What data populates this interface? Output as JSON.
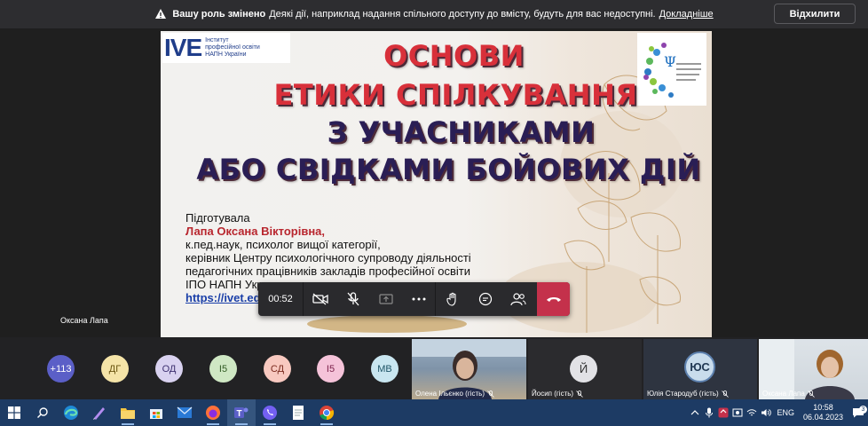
{
  "banner": {
    "bold": "Вашу роль змінено",
    "message": "Деякі дії, наприклад надання спільного доступу до вмісту, будуть для вас недоступні.",
    "link": "Докладніше",
    "dismiss": "Відхилити"
  },
  "slide": {
    "logo_mark": "IVE",
    "logo_text": [
      "Інститут",
      "професійної освіти",
      "НАПН України"
    ],
    "title_lines": [
      "ОСНОВИ",
      "ЕТИКИ СПІЛКУВАННЯ",
      "З УЧАСНИКАМИ",
      "АБО СВІДКАМИ БОЙОВИХ ДІЙ"
    ],
    "prepared": "Підготувала",
    "author_name": "Лапа Оксана Вікторівна,",
    "author_lines": [
      "к.пед.наук, психолог вищої категорії,",
      "керівник Центру психологічного супроводу діяльності",
      "педагогічних працівників закладів професійної освіти",
      "ІПО НАПН Укр"
    ],
    "link_visible": "https://ivet.ed"
  },
  "presenter_name": "Оксана Лапа",
  "call": {
    "timer": "00:52"
  },
  "participants": {
    "avatars": [
      {
        "initials": "+113",
        "color": "#5b5fc7",
        "text_color": "#ffffff"
      },
      {
        "initials": "ДГ",
        "color": "#f5e4a8",
        "text_color": "#6a5410"
      },
      {
        "initials": "ОД",
        "color": "#d9d2f0",
        "text_color": "#3e3170"
      },
      {
        "initials": "І5",
        "color": "#cfe8c4",
        "text_color": "#2f5a22"
      },
      {
        "initials": "СД",
        "color": "#f8c9c0",
        "text_color": "#7a2a1e"
      },
      {
        "initials": "І5",
        "color": "#f5c3d9",
        "text_color": "#7a1f48"
      },
      {
        "initials": "МВ",
        "color": "#c9e6f0",
        "text_color": "#1e5466"
      }
    ],
    "tiles": [
      {
        "name": "Олена Ільєнко (гість)"
      },
      {
        "name": "Йосип (гість)",
        "initials": "Й"
      },
      {
        "name": "Юлія Стародуб (гість)",
        "initials": "ЮС"
      },
      {
        "name": "Оксана Лапа"
      }
    ]
  },
  "taskbar": {
    "apps": [
      "windows-start",
      "search",
      "edge",
      "pen",
      "file-explorer",
      "store",
      "mail",
      "firefox",
      "teams",
      "viber",
      "notepad",
      "chrome"
    ],
    "lang": "ENG",
    "time": "10:58",
    "date": "06.04.2023",
    "notifications": "3"
  }
}
